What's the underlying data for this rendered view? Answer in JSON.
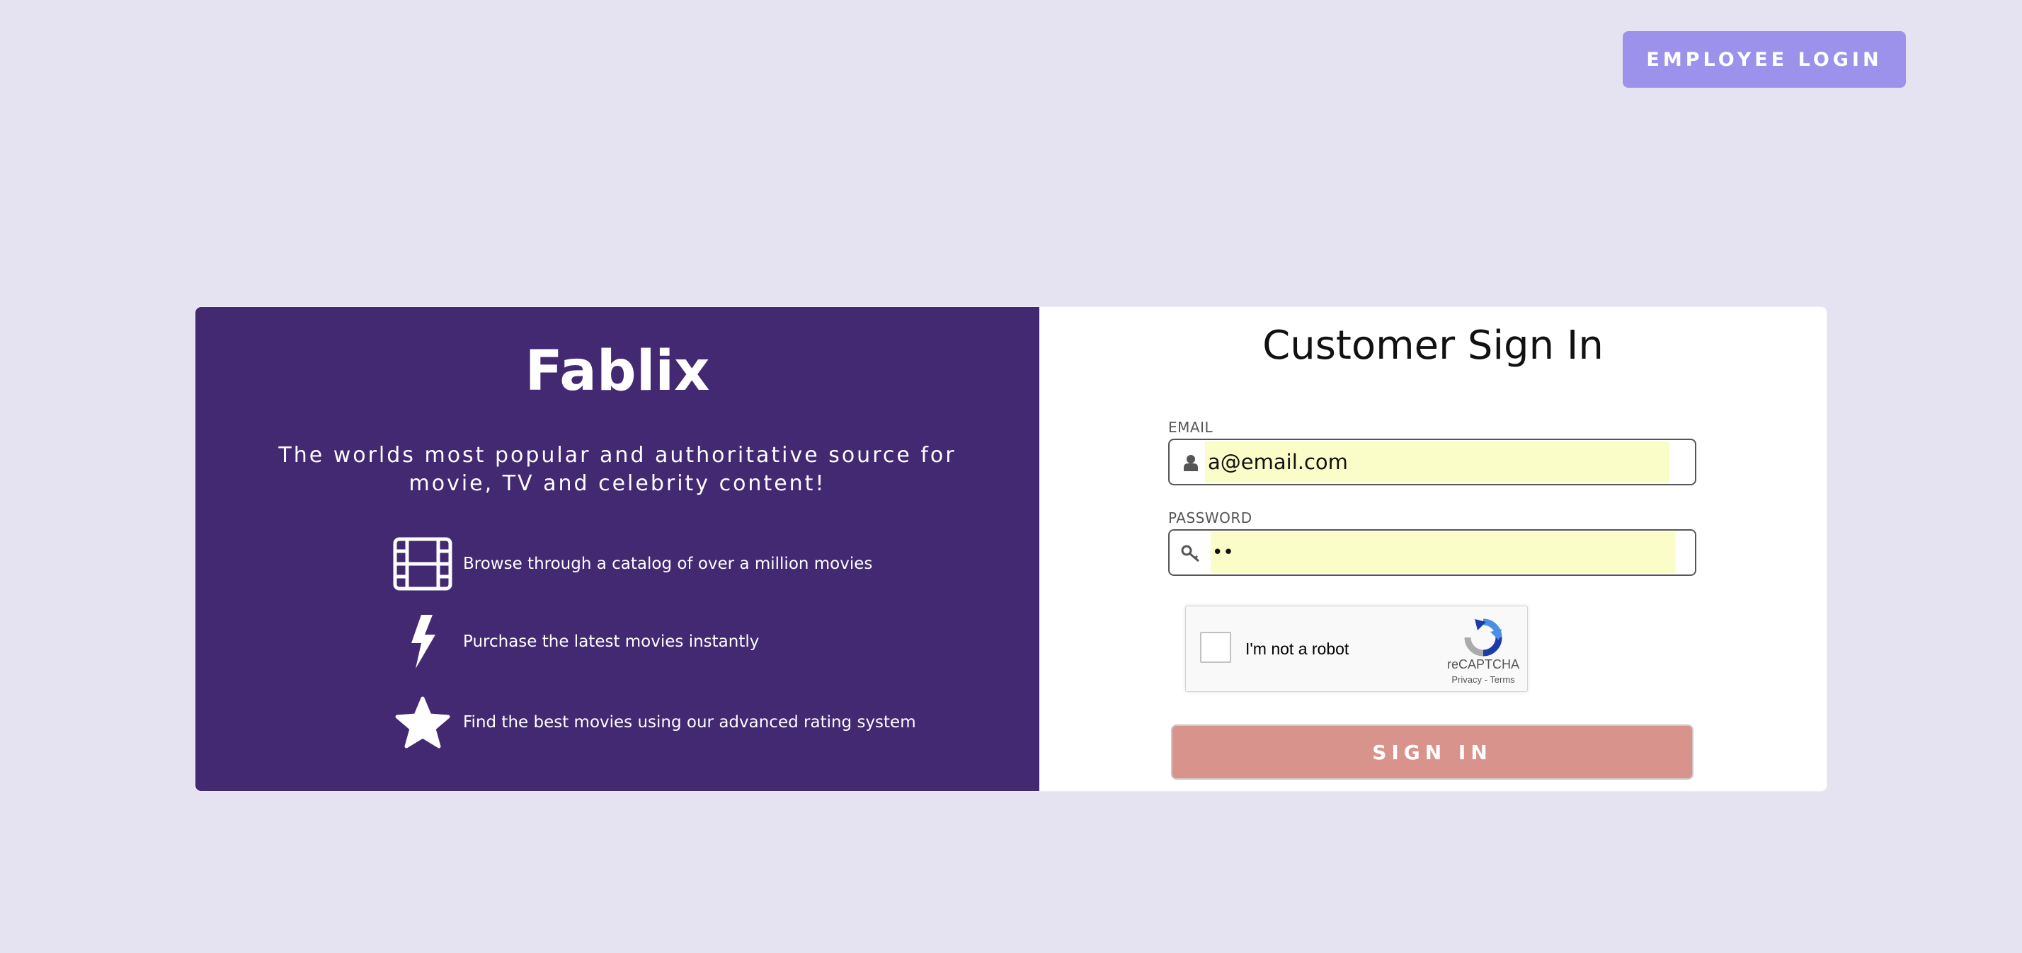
{
  "header": {
    "employee_login_label": "EMPLOYEE LOGIN"
  },
  "brand_panel": {
    "brand_name": "Fablix",
    "tagline": "The worlds most popular and authoritative source for movie, TV and celebrity content!",
    "features": [
      {
        "icon": "film-icon",
        "text": "Browse through a catalog of over a million movies"
      },
      {
        "icon": "lightning-bolt-icon",
        "text": "Purchase the latest movies instantly"
      },
      {
        "icon": "star-icon",
        "text": "Find the best movies using our advanced rating system"
      }
    ]
  },
  "login_form": {
    "title": "Customer Sign In",
    "email": {
      "label": "EMAIL",
      "value": "a@email.com",
      "icon": "user-icon"
    },
    "password": {
      "label": "PASSWORD",
      "value": "••",
      "icon": "key-icon"
    },
    "recaptcha": {
      "label": "I'm not a robot",
      "brand": "reCAPTCHA",
      "privacy": "Privacy",
      "separator": " - ",
      "terms": "Terms",
      "checked": false
    },
    "submit_label": "SIGN IN"
  },
  "colors": {
    "page_background": "#e5e3f2",
    "employee_button": "#9c92ec",
    "brand_panel": "#432872",
    "autofill": "#fafdc7",
    "signin_button": "#d8938c"
  }
}
